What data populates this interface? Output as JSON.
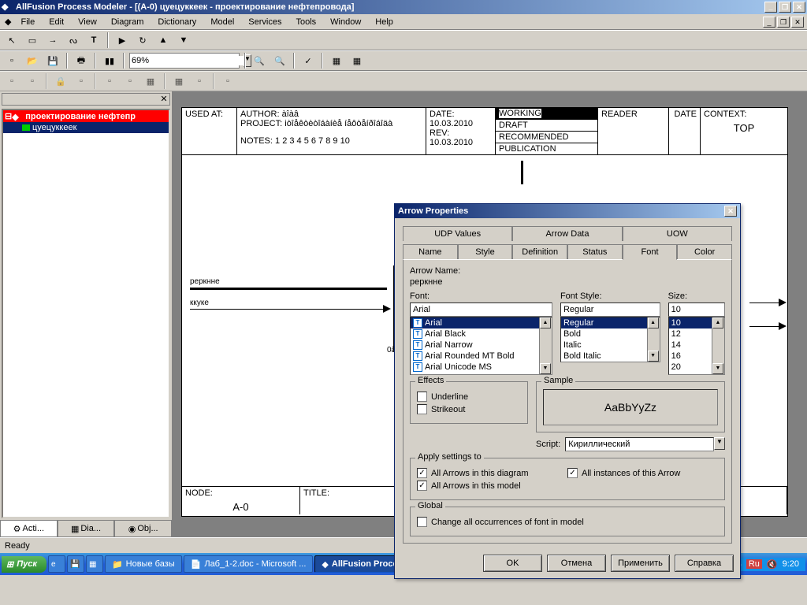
{
  "window": {
    "title": "AllFusion Process Modeler - [(A-0) цуецуккеек - проектирование нефтепровода]"
  },
  "menu": {
    "file": "File",
    "edit": "Edit",
    "view": "View",
    "diagram": "Diagram",
    "dictionary": "Dictionary",
    "model": "Model",
    "services": "Services",
    "tools": "Tools",
    "window": "Window",
    "help": "Help"
  },
  "toolbar": {
    "zoom": "69%"
  },
  "tree": {
    "root": "проектирование нефтепр",
    "child": "цуецуккеек"
  },
  "side_tabs": {
    "acti": "Acti...",
    "dia": "Dia...",
    "obj": "Obj..."
  },
  "diagram": {
    "used_at": "USED AT:",
    "author_label": "AUTHOR:",
    "author": "àîàâ",
    "project_label": "PROJECT:",
    "project": "iòîåêòèòîáàíèå íåôòåíðîáîäà",
    "notes_label": "NOTES:",
    "notes": "1  2  3  4  5  6  7  8  9  10",
    "date_label": "DATE:",
    "date": "10.03.2010",
    "rev_label": "REV:",
    "rev": "10.03.2010",
    "working": "WORKING",
    "draft": "DRAFT",
    "recommended": "RECOMMENDED",
    "publication": "PUBLICATION",
    "reader": "READER",
    "date2": "DATE",
    "context": "CONTEXT:",
    "top": "TOP",
    "node_label": "NODE:",
    "node": "A-0",
    "title_label": "TITLE:",
    "arrow1": "реркнне",
    "arrow2": "ккуке",
    "arrow3": "0â"
  },
  "dialog": {
    "title": "Arrow Properties",
    "tabs_top": {
      "udp": "UDP Values",
      "arrow_data": "Arrow Data",
      "uow": "UOW"
    },
    "tabs_bottom": {
      "name": "Name",
      "style": "Style",
      "definition": "Definition",
      "status": "Status",
      "font": "Font",
      "color": "Color"
    },
    "arrow_name_label": "Arrow Name:",
    "arrow_name": "реркнне",
    "font_label": "Font:",
    "font_value": "Arial",
    "fonts": [
      "Arial",
      "Arial Black",
      "Arial Narrow",
      "Arial Rounded MT Bold",
      "Arial Unicode MS"
    ],
    "font_style_label": "Font Style:",
    "font_style_value": "Regular",
    "styles": [
      "Regular",
      "Bold",
      "Italic",
      "Bold Italic"
    ],
    "size_label": "Size:",
    "size_value": "10",
    "sizes": [
      "10",
      "12",
      "14",
      "16",
      "20"
    ],
    "effects_label": "Effects",
    "underline": "Underline",
    "strikeout": "Strikeout",
    "sample_label": "Sample",
    "sample_text": "AaBbYyZz",
    "script_label": "Script:",
    "script_value": "Кириллический",
    "apply_label": "Apply settings to",
    "all_diagram": "All Arrows in this diagram",
    "all_model": "All Arrows in this model",
    "all_instances": "All instances of this Arrow",
    "global_label": "Global",
    "change_all": "Change all occurrences of font in model",
    "ok": "OK",
    "cancel": "Отмена",
    "apply": "Применить",
    "help": "Справка"
  },
  "status": {
    "ready": "Ready"
  },
  "taskbar": {
    "start": "Пуск",
    "items": [
      "Новые базы",
      "Лаб_1-2.doc - Microsoft ...",
      "AllFusion Process Mo..."
    ],
    "lang": "Ru",
    "time": "9:20"
  }
}
